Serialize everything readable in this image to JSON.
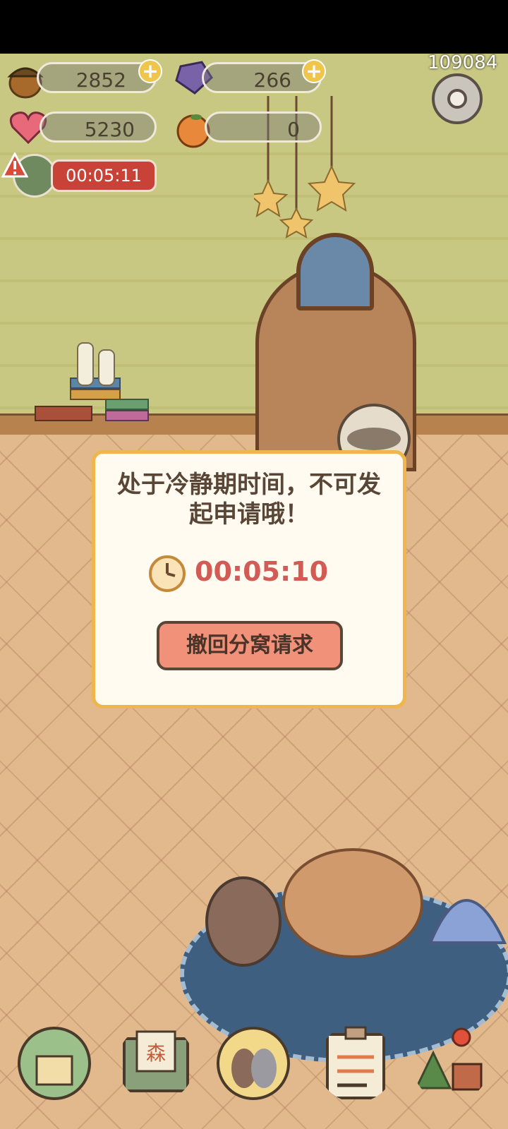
{
  "hud": {
    "acorns": "2852",
    "gems": "266",
    "hearts": "5230",
    "oranges": "0",
    "house_timer": "00:05:11",
    "player_id": "109084"
  },
  "dialog": {
    "message": "处于冷静期时间，不可发起申请哦！",
    "countdown": "00:05:10",
    "button_label": "撤回分窝请求"
  },
  "bottom_nav": {
    "items": [
      "house-icon",
      "mail-icon",
      "friends-icon",
      "tasks-clipboard-icon",
      "map-icon"
    ],
    "mail_badge": "森"
  },
  "colors": {
    "accent": "#f0b64d",
    "timer_red": "#c84238",
    "button": "#f1917a"
  }
}
